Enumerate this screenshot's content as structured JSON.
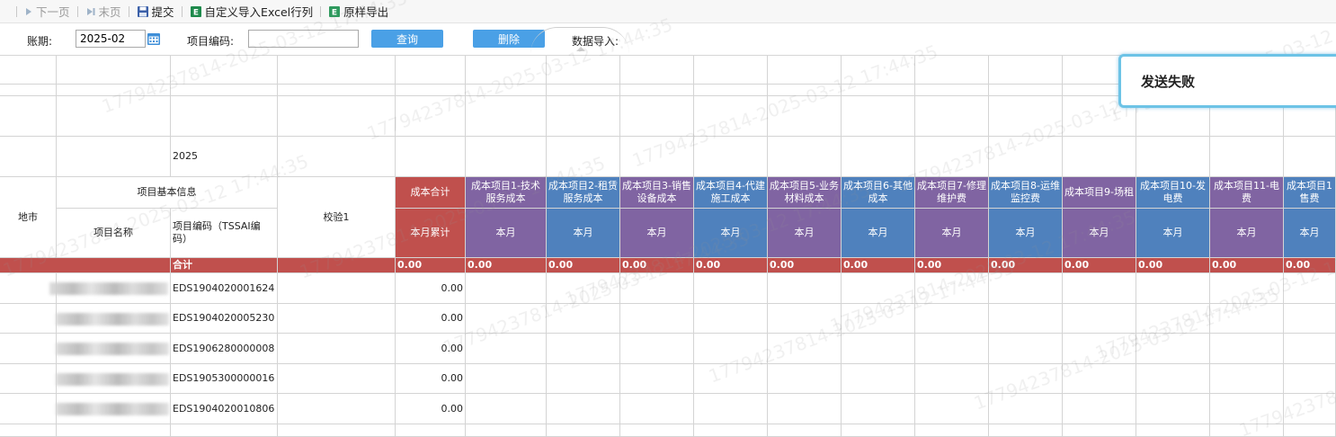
{
  "toolbar": {
    "next_page": "下一页",
    "last_page": "末页",
    "submit": "提交",
    "custom_import": "自定义导入Excel行列",
    "export_raw": "原样导出"
  },
  "filter": {
    "period_label": "账期:",
    "period_value": "2025-02",
    "project_code_label": "项目编码:",
    "project_code_value": "",
    "query_button": "查询",
    "delete_button": "删除",
    "data_import_label": "数据导入:"
  },
  "toast": {
    "message": "发送失败"
  },
  "watermark": "17794237814-2025-03-12 17:44:35",
  "table": {
    "year": "2025",
    "col_city": "地市",
    "group_basic_info": "项目基本信息",
    "col_project_name": "项目名称",
    "col_project_code": "项目编码（TSSAI编码）",
    "col_check": "校验1",
    "col_cost_total": "成本合计",
    "col_cost_total_sub": "本月累计",
    "cost_items": [
      {
        "name": "成本项目1-技术服务成本",
        "sub": "本月",
        "total": "0.00"
      },
      {
        "name": "成本项目2-租赁服务成本",
        "sub": "本月",
        "total": "0.00"
      },
      {
        "name": "成本项目3-销售设备成本",
        "sub": "本月",
        "total": "0.00"
      },
      {
        "name": "成本项目4-代建施工成本",
        "sub": "本月",
        "total": "0.00"
      },
      {
        "name": "成本项目5-业务材料成本",
        "sub": "本月",
        "total": "0.00"
      },
      {
        "name": "成本项目6-其他成本",
        "sub": "本月",
        "total": "0.00"
      },
      {
        "name": "成本项目7-修理维护费",
        "sub": "本月",
        "total": "0.00"
      },
      {
        "name": "成本项目8-运维监控费",
        "sub": "本月",
        "total": "0.00"
      },
      {
        "name": "成本项目9-场租",
        "sub": "本月",
        "total": "0.00"
      },
      {
        "name": "成本项目10-发电费",
        "sub": "本月",
        "total": "0.00"
      },
      {
        "name": "成本项目11-电费",
        "sub": "本月",
        "total": "0.00"
      },
      {
        "name": "成本项目1售费",
        "sub": "本月",
        "total": "0.00"
      }
    ],
    "total_label": "合计",
    "total_value": "0.00",
    "rows": [
      {
        "code": "EDS1904020001624",
        "cost_total": "0.00"
      },
      {
        "code": "EDS1904020005230",
        "cost_total": "0.00"
      },
      {
        "code": "EDS1906280000008",
        "cost_total": "0.00"
      },
      {
        "code": "EDS1905300000016",
        "cost_total": "0.00"
      },
      {
        "code": "EDS1904020010806",
        "cost_total": "0.00"
      }
    ]
  }
}
